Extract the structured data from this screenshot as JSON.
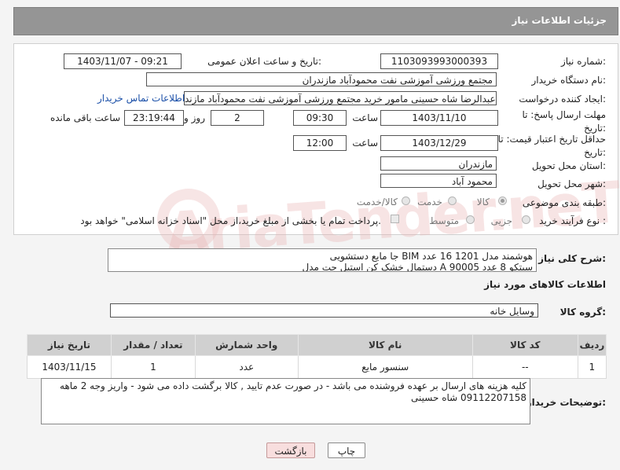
{
  "header": {
    "title": "جزئیات اطلاعات نیاز"
  },
  "form": {
    "need_number_label": "شماره نیاز:",
    "need_number": "1103093993000393",
    "announce_label": "تاریخ و ساعت اعلان عمومی:",
    "announce_value": "1403/11/07 - 09:21",
    "buyer_org_label": "نام دستگاه خریدار:",
    "buyer_org": "مجتمع ورزشی آموزشی نفت محمودآباد مازندران",
    "creator_label": "ایجاد کننده درخواست:",
    "creator": "عبدالرضا شاه حسینی مامور خرید مجتمع ورزشی آموزشی نفت محمودآباد مازند",
    "contact_link": "اطلاعات تماس خریدار",
    "deadline_label_1": "مهلت ارسال پاسخ: تا",
    "deadline_label_2": "تاریخ:",
    "deadline_date": "1403/11/10",
    "time_label": "ساعت",
    "deadline_time": "09:30",
    "days_value": "2",
    "days_label": "روز و",
    "remaining_time": "23:19:44",
    "remaining_label": "ساعت باقی مانده",
    "validity_label_1": "حداقل تاریخ اعتبار قیمت: تا",
    "validity_label_2": "تاریخ:",
    "validity_date": "1403/12/29",
    "validity_time": "12:00",
    "province_label": "استان محل تحویل:",
    "province": "مازندران",
    "city_label": "شهر محل تحویل:",
    "city": "محمود آباد",
    "category_label": "طبقه بندی موضوعی:",
    "category_options": [
      "کالا",
      "خدمت",
      "کالا/خدمت"
    ],
    "process_label": "نوع فرآیند خرید :",
    "process_options": [
      "جزیی",
      "متوسط"
    ],
    "process_note": "پرداخت تمام یا بخشی از مبلغ خرید،از محل \"اسناد خزانه اسلامی\" خواهد بود."
  },
  "summary": {
    "label": "شرح کلی نیاز:",
    "line1": "جا مایع دستشویی BIM هوشمند مدل 1201      16  عدد",
    "line2": "دستمال خشک کن استیل جت مدل A 90005 سیتکو     8    عدد"
  },
  "goods": {
    "section_title": "اطلاعات کالاهای مورد نیاز",
    "group_label": "گروه کالا:",
    "group_value": "وسایل خانه",
    "columns": [
      "ردیف",
      "کد کالا",
      "نام کالا",
      "واحد شمارش",
      "تعداد / مقدار",
      "تاریخ نیاز"
    ],
    "rows": [
      {
        "row": "1",
        "code": "--",
        "name": "سنسور مایع",
        "unit": "عدد",
        "qty": "1",
        "date": "1403/11/15"
      }
    ]
  },
  "buyer_notes": {
    "label": "توضیحات خریدار:",
    "text": "کلیه هزینه های ارسال بر عهده فروشنده می باشد - در صورت عدم تایید , کالا برگشت داده می شود - واریز وجه 2 ماهه 09112207158 شاه حسینی"
  },
  "buttons": {
    "print": "چاپ",
    "back": "بازگشت"
  },
  "colors": {
    "header_bg": "#959595",
    "link": "#1a4fa8",
    "back_button_bg": "#f8dede"
  }
}
